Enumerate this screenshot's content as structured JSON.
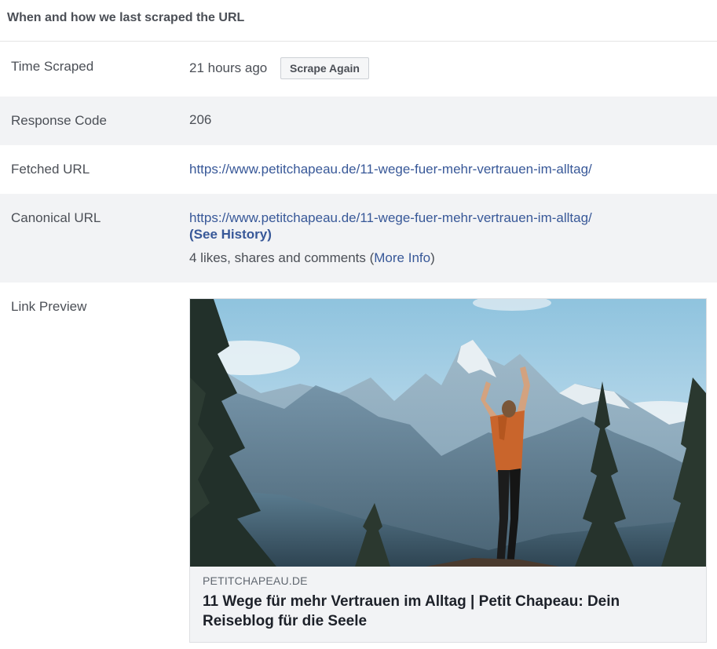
{
  "header": {
    "title": "When and how we last scraped the URL"
  },
  "rows": {
    "time_scraped": {
      "label": "Time Scraped",
      "value": "21 hours ago",
      "button": "Scrape Again"
    },
    "response_code": {
      "label": "Response Code",
      "value": "206"
    },
    "fetched_url": {
      "label": "Fetched URL",
      "value": "https://www.petitchapeau.de/11-wege-fuer-mehr-vertrauen-im-alltag/"
    },
    "canonical_url": {
      "label": "Canonical URL",
      "value": "https://www.petitchapeau.de/11-wege-fuer-mehr-vertrauen-im-alltag/",
      "history_link": "(See History)",
      "engagement_text": "4 likes, shares and comments (",
      "more_info_link": "More Info",
      "engagement_close": ")"
    },
    "link_preview": {
      "label": "Link Preview",
      "domain": "PETITCHAPEAU.DE",
      "title": "11 Wege für mehr Vertrauen im Alltag | Petit Chapeau: Dein Reiseblog für die Seele"
    }
  },
  "colors": {
    "link": "#385898",
    "alt_row": "#f2f3f5",
    "text": "#4b4f56"
  }
}
